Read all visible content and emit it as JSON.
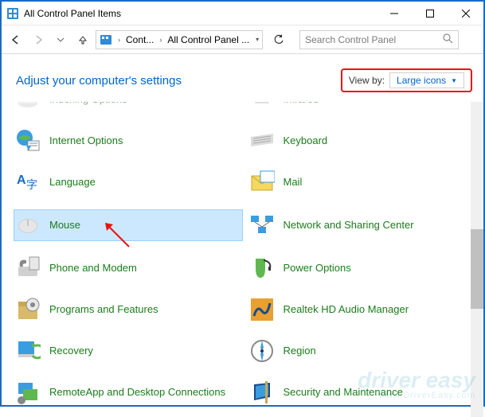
{
  "window": {
    "title": "All Control Panel Items"
  },
  "breadcrumb": {
    "part1": "Cont...",
    "part2": "All Control Panel ..."
  },
  "search": {
    "placeholder": "Search Control Panel"
  },
  "header": {
    "title": "Adjust your computer's settings"
  },
  "viewby": {
    "label": "View by:",
    "value": "Large icons"
  },
  "items": {
    "left": [
      {
        "label": "Indexing Options"
      },
      {
        "label": "Internet Options"
      },
      {
        "label": "Language"
      },
      {
        "label": "Mouse"
      },
      {
        "label": "Phone and Modem"
      },
      {
        "label": "Programs and Features"
      },
      {
        "label": "Recovery"
      },
      {
        "label": "RemoteApp and Desktop Connections"
      }
    ],
    "right": [
      {
        "label": "Infrared"
      },
      {
        "label": "Keyboard"
      },
      {
        "label": "Mail"
      },
      {
        "label": "Network and Sharing Center"
      },
      {
        "label": "Power Options"
      },
      {
        "label": "Realtek HD Audio Manager"
      },
      {
        "label": "Region"
      },
      {
        "label": "Security and Maintenance"
      }
    ]
  },
  "watermark": {
    "brand": "driver easy",
    "url": "www.DriverEasy.com"
  }
}
